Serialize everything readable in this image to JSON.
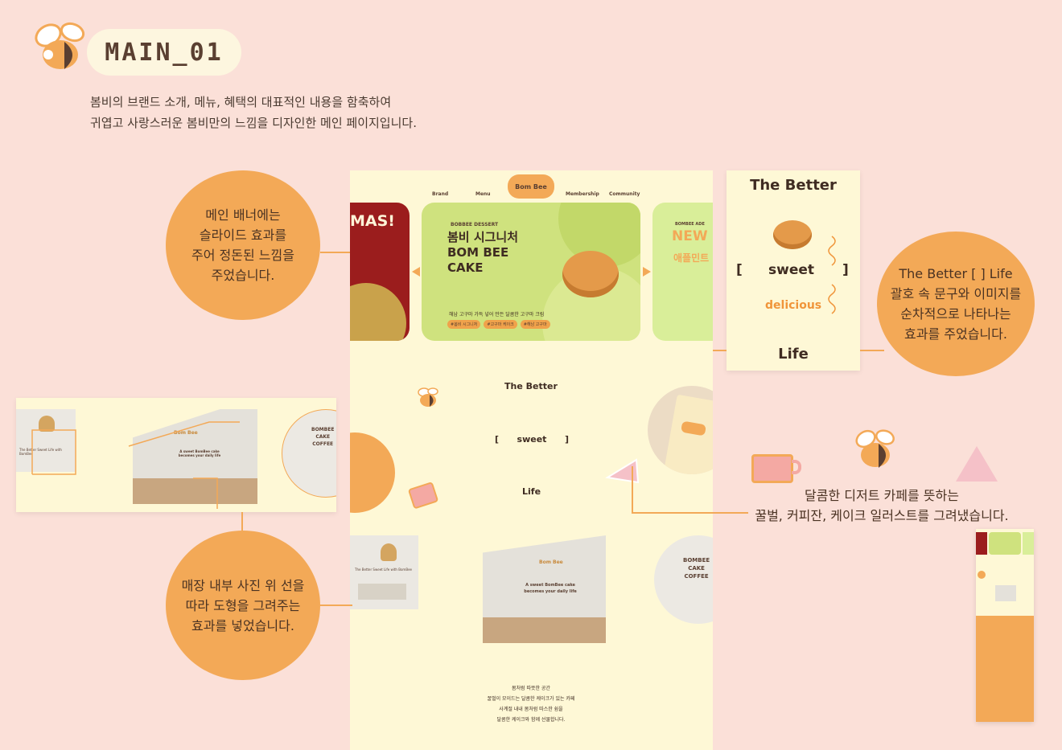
{
  "header": {
    "title": "MAIN_01",
    "intro_line1": "봄비의 브랜드 소개, 메뉴, 혜택의 대표적인 내용을 함축하여",
    "intro_line2": "귀엽고 사랑스러운 봄비만의 느낌을 디자인한 메인 페이지입니다."
  },
  "annotations": {
    "banner_l1": "메인 배너에는",
    "banner_l2": "슬라이드 효과를",
    "banner_l3": "주어 정돈된 느낌을",
    "banner_l4": "주었습니다.",
    "better_l1": "The Better [   ] Life",
    "better_l2": "괄호 속 문구와 이미지를",
    "better_l3": "순차적으로 나타나는",
    "better_l4": "효과를 주었습니다.",
    "store_l1": "매장 내부 사진 위 선을",
    "store_l2": "따라 도형을 그려주는",
    "store_l3": "효과를 넣었습니다.",
    "illust_l1": "달콤한 디저트 카페를 뜻하는",
    "illust_l2": "꿀벌, 커피잔, 케이크 일러스트를 그려냈습니다."
  },
  "mock": {
    "nav": {
      "brand": "Brand",
      "menu": "Menu",
      "membership": "Membership",
      "community": "Community",
      "logo": "Bom Bee"
    },
    "slide_left_text": "MAS!",
    "slide": {
      "tag": "BOBBEE DESSERT",
      "title_l1": "봄비 시그니처",
      "title_l2": "BOM BEE",
      "title_l3": "CAKE",
      "desc": "해남 고구마 가득 넣어 만든 달콤한 고구마 크림",
      "tags": [
        "#봄비 시그니처",
        "#고구마 케이크",
        "#해남 고구마"
      ]
    },
    "slide_right": {
      "tag": "BOMBEE ADE",
      "t1": "NEW",
      "t2": "애플민트"
    },
    "better": {
      "the_better": "The Better",
      "bracket_open": "[",
      "bracket_close": "]",
      "word": "sweet",
      "life": "Life"
    },
    "cafe": {
      "sign_l1": "BOMBEE",
      "sign_l2": "CAKE",
      "sign_l3": "COFFEE",
      "photo_caption": "The Better Sweet Life with BomBee",
      "wall_logo": "Bom Bee",
      "wall_text_l1": "A sweet BomBee cake",
      "wall_text_l2": "becomes your daily life"
    },
    "story": {
      "l1": "봄처럼 따뜻한 공간",
      "l2": "꿀벌이 모이드는 달콤한 케이크가 있는 카페",
      "l3": "사계절 내내 봄처럼 따스한 쉼을",
      "l4": "달콤한 케이크와 함께 선물합니다."
    }
  },
  "card": {
    "the_better": "The Better",
    "open": "[",
    "close": "]",
    "sweet": "sweet",
    "delicious": "delicious",
    "life": "Life"
  },
  "colors": {
    "background": "#fbe0d8",
    "accent": "#f3a957",
    "cream": "#fef8d6",
    "text": "#5a3f31"
  }
}
